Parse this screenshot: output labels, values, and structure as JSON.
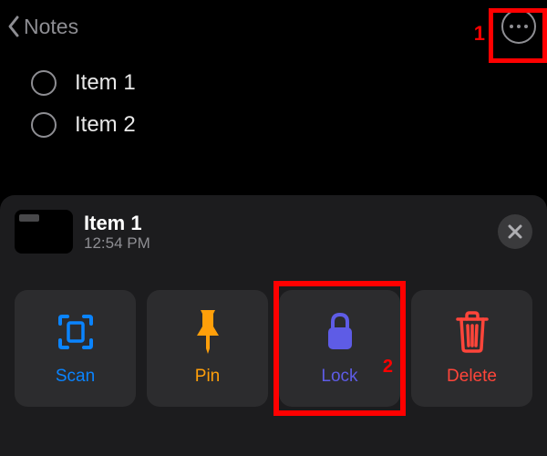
{
  "nav": {
    "back_label": "Notes"
  },
  "annotations": {
    "a1": "1",
    "a2": "2"
  },
  "list": {
    "items": [
      {
        "label": "Item 1"
      },
      {
        "label": "Item 2"
      }
    ]
  },
  "sheet": {
    "title": "Item 1",
    "time": "12:54 PM",
    "actions": {
      "scan": {
        "label": "Scan"
      },
      "pin": {
        "label": "Pin"
      },
      "lock": {
        "label": "Lock"
      },
      "delete": {
        "label": "Delete"
      }
    }
  }
}
